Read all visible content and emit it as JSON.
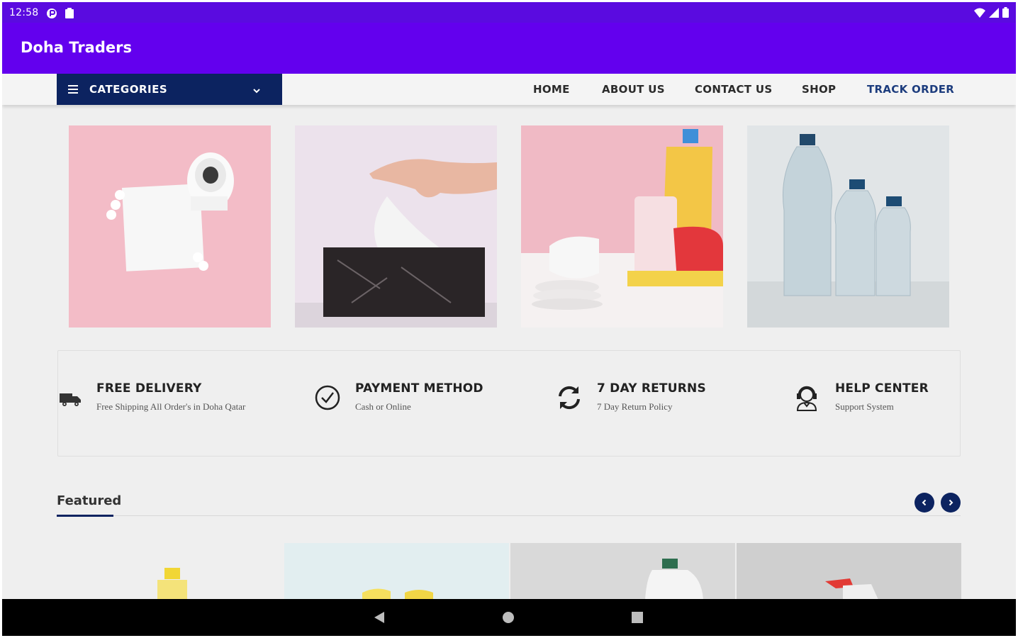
{
  "status_bar": {
    "time": "12:58",
    "icons_left": [
      "nfc-icon",
      "clipboard-icon"
    ],
    "icons_right": [
      "wifi-icon",
      "cellular-icon",
      "battery-icon"
    ]
  },
  "app_bar": {
    "title": "Doha Traders"
  },
  "nav": {
    "categories_label": "CATEGORIES",
    "links": [
      {
        "label": "HOME"
      },
      {
        "label": "ABOUT US"
      },
      {
        "label": "CONTACT US"
      },
      {
        "label": "SHOP"
      },
      {
        "label": "TRACK ORDER"
      }
    ]
  },
  "banner_tiles": [
    {
      "subject": "toilet paper roll and napkin on pink"
    },
    {
      "subject": "hand pulling tissue from marble box"
    },
    {
      "subject": "dish soap bottles and plates"
    },
    {
      "subject": "water bottles"
    }
  ],
  "features": [
    {
      "icon": "truck-icon",
      "title": "FREE DELIVERY",
      "desc": "Free Shipping All Order's in Doha Qatar"
    },
    {
      "icon": "check-circle-icon",
      "title": "PAYMENT METHOD",
      "desc": "Cash or Online"
    },
    {
      "icon": "refresh-icon",
      "title": "7 DAY RETURNS",
      "desc": "7 Day Return Policy"
    },
    {
      "icon": "support-agent-icon",
      "title": "HELP CENTER",
      "desc": "Support System"
    }
  ],
  "featured": {
    "title": "Featured"
  },
  "colors": {
    "status_bar": "#5a0be0",
    "app_bar": "#6300ee",
    "navy": "#0c2360",
    "accent_link": "#1d3d7e",
    "page_bg": "#efefef"
  }
}
